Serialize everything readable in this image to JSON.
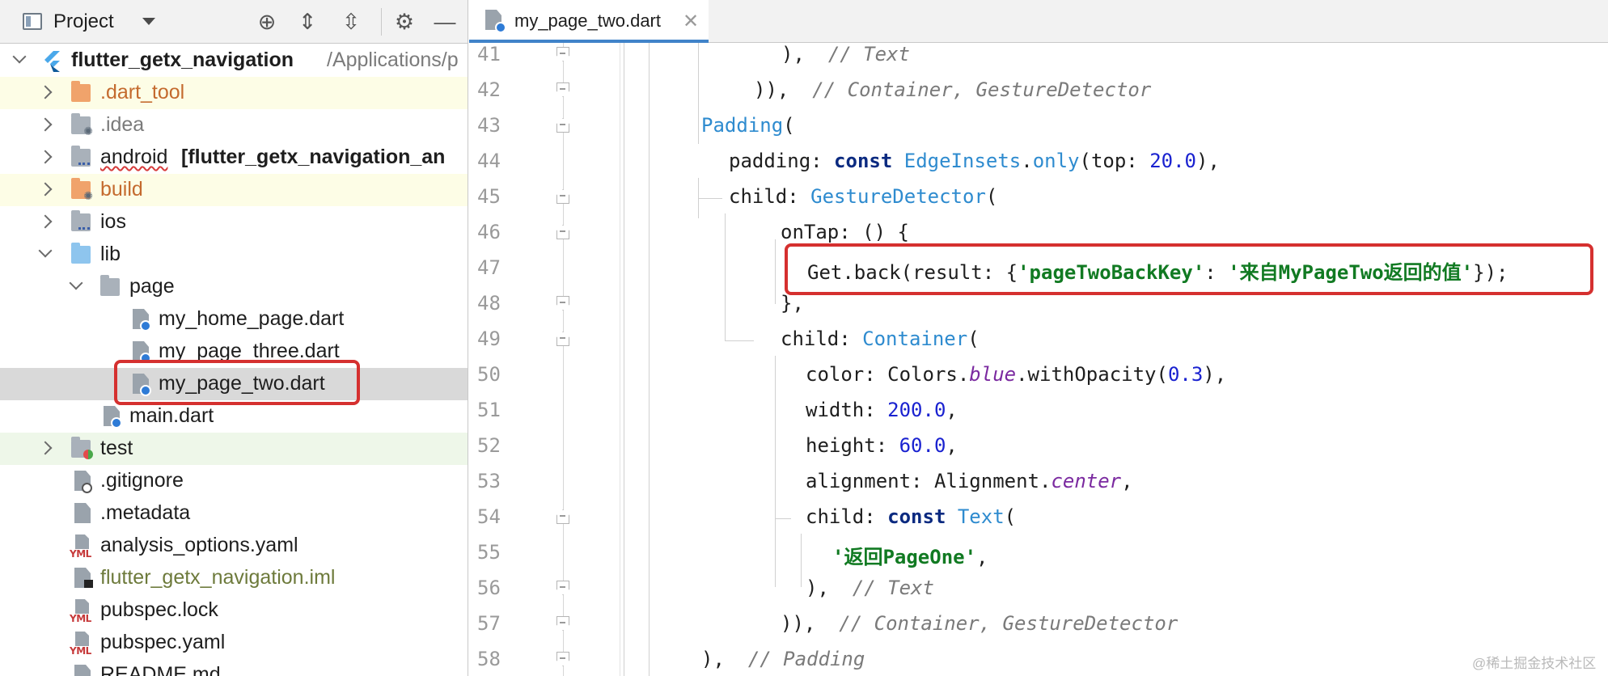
{
  "project_panel": {
    "title": "Project",
    "items": [
      {
        "label": "flutter_getx_navigation",
        "suffix": "/Applications/p",
        "icon": "flutter-logo-icon"
      },
      {
        "label": ".dart_tool",
        "icon": "folder-icon"
      },
      {
        "label": ".idea",
        "icon": "folder-icon"
      },
      {
        "label": "android",
        "suffix": "[flutter_getx_navigation_an",
        "icon": "folder-icon"
      },
      {
        "label": "build",
        "icon": "folder-icon"
      },
      {
        "label": "ios",
        "icon": "folder-icon"
      },
      {
        "label": "lib",
        "icon": "folder-icon"
      },
      {
        "label": "page",
        "icon": "folder-icon"
      },
      {
        "label": "my_home_page.dart",
        "icon": "dart-file-icon"
      },
      {
        "label": "my_page_three.dart",
        "icon": "dart-file-icon"
      },
      {
        "label": "my_page_two.dart",
        "icon": "dart-file-icon"
      },
      {
        "label": "main.dart",
        "icon": "dart-file-icon"
      },
      {
        "label": "test",
        "icon": "folder-icon"
      },
      {
        "label": ".gitignore",
        "icon": "file-icon"
      },
      {
        "label": ".metadata",
        "icon": "file-icon"
      },
      {
        "label": "analysis_options.yaml",
        "icon": "yml-file-icon"
      },
      {
        "label": "flutter_getx_navigation.iml",
        "icon": "iml-file-icon"
      },
      {
        "label": "pubspec.lock",
        "icon": "yml-file-icon"
      },
      {
        "label": "pubspec.yaml",
        "icon": "yml-file-icon"
      },
      {
        "label": "README.md",
        "icon": "file-icon"
      }
    ]
  },
  "editor": {
    "tab_label": "my_page_two.dart",
    "line_numbers": [
      "41",
      "42",
      "43",
      "44",
      "45",
      "46",
      "47",
      "48",
      "49",
      "50",
      "51",
      "52",
      "53",
      "54",
      "55",
      "56",
      "57",
      "58"
    ],
    "code": {
      "l41": {
        "a": "),",
        "cm": "// Text"
      },
      "l42": {
        "a": ")),",
        "cm": "// Container, GestureDetector"
      },
      "l43": {
        "cls": "Padding",
        "p": "("
      },
      "l44": {
        "a": "padding: ",
        "kw": "const",
        "cls": "EdgeInsets",
        "dot": ".",
        "call": "only",
        "b": "(top: ",
        "num": "20.0",
        "c": "),"
      },
      "l45": {
        "a": "child: ",
        "cls": "GestureDetector",
        "p": "("
      },
      "l46": {
        "a": "onTap: () {"
      },
      "l47": {
        "a": "Get.back(result: {",
        "str1": "'pageTwoBackKey'",
        "b": ": ",
        "str2": "'来自MyPageTwo返回的值'",
        "c": "});"
      },
      "l48": {
        "a": "},"
      },
      "l49": {
        "a": "child: ",
        "cls": "Container",
        "p": "("
      },
      "l50": {
        "a": "color: Colors.",
        "ital": "blue",
        "b": ".withOpacity(",
        "num": "0.3",
        "c": "),"
      },
      "l51": {
        "a": "width: ",
        "num": "200.0",
        "c": ","
      },
      "l52": {
        "a": "height: ",
        "num": "60.0",
        "c": ","
      },
      "l53": {
        "a": "alignment: Alignment.",
        "ital": "center",
        "c": ","
      },
      "l54": {
        "a": "child: ",
        "kw": "const",
        "cls": "Text",
        "p": "("
      },
      "l55": {
        "str": "'返回PageOne'",
        "c": ","
      },
      "l56": {
        "a": "),",
        "cm": "// Text"
      },
      "l57": {
        "a": ")),",
        "cm": "// Container, GestureDetector"
      },
      "l58": {
        "a": "),",
        "cm": "// Padding"
      }
    }
  },
  "watermark": "@稀土掘金技术社区",
  "colors": {
    "highlight_box": "#d5302f",
    "accent": "#4083c9"
  }
}
